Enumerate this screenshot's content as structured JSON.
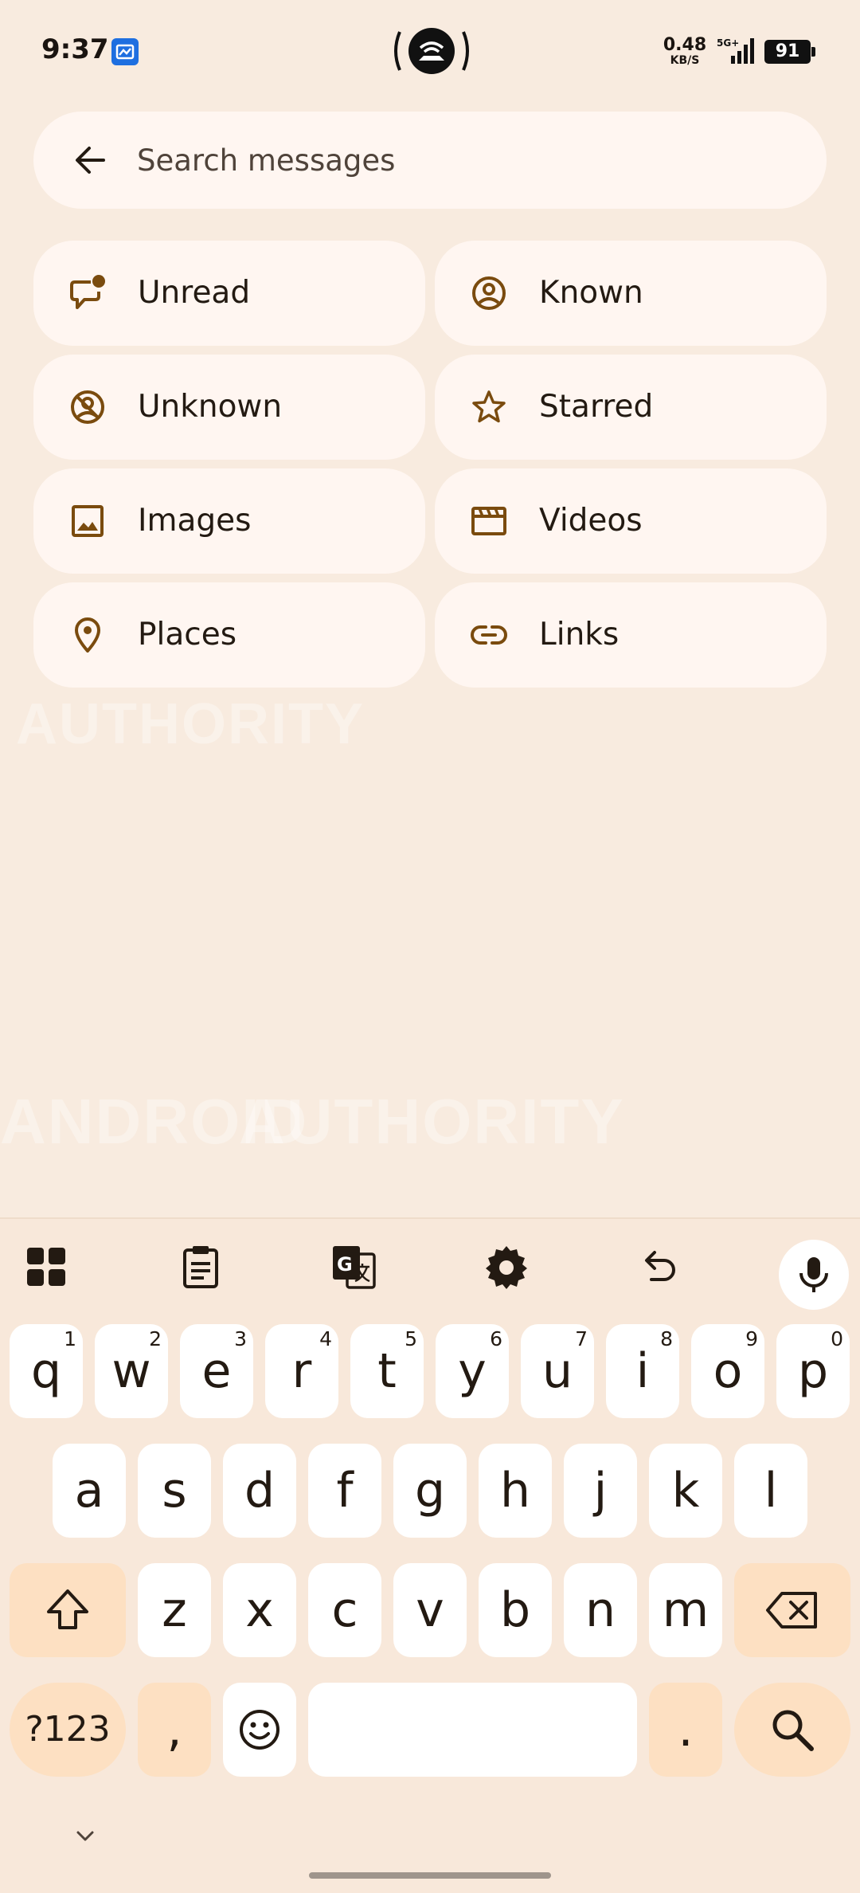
{
  "status_bar": {
    "time": "9:37",
    "net_speed_value": "0.48",
    "net_speed_unit": "KB/S",
    "network_type": "5G+",
    "battery": "91"
  },
  "search": {
    "placeholder": "Search messages"
  },
  "filters": [
    {
      "label": "Unread",
      "icon": "unread-chat-icon"
    },
    {
      "label": "Known",
      "icon": "known-contact-icon"
    },
    {
      "label": "Unknown",
      "icon": "unknown-contact-icon"
    },
    {
      "label": "Starred",
      "icon": "star-icon"
    },
    {
      "label": "Images",
      "icon": "image-icon"
    },
    {
      "label": "Videos",
      "icon": "video-icon"
    },
    {
      "label": "Places",
      "icon": "location-pin-icon"
    },
    {
      "label": "Links",
      "icon": "link-icon"
    }
  ],
  "watermark": {
    "text_1": "AUTHORITY",
    "text_2": "ANDROID",
    "text_3": "AUTHORITY"
  },
  "keyboard": {
    "row1": [
      {
        "key": "q",
        "hint": "1"
      },
      {
        "key": "w",
        "hint": "2"
      },
      {
        "key": "e",
        "hint": "3"
      },
      {
        "key": "r",
        "hint": "4"
      },
      {
        "key": "t",
        "hint": "5"
      },
      {
        "key": "y",
        "hint": "6"
      },
      {
        "key": "u",
        "hint": "7"
      },
      {
        "key": "i",
        "hint": "8"
      },
      {
        "key": "o",
        "hint": "9"
      },
      {
        "key": "p",
        "hint": "0"
      }
    ],
    "row2": [
      "a",
      "s",
      "d",
      "f",
      "g",
      "h",
      "j",
      "k",
      "l"
    ],
    "row3": [
      "z",
      "x",
      "c",
      "v",
      "b",
      "n",
      "m"
    ],
    "symbols_label": "?123",
    "comma_label": ",",
    "period_label": "."
  },
  "colors": {
    "background": "#f8ebdf",
    "chip": "#fff6f1",
    "icon_accent": "#7a4b0e",
    "function_key": "#fde0c2"
  }
}
